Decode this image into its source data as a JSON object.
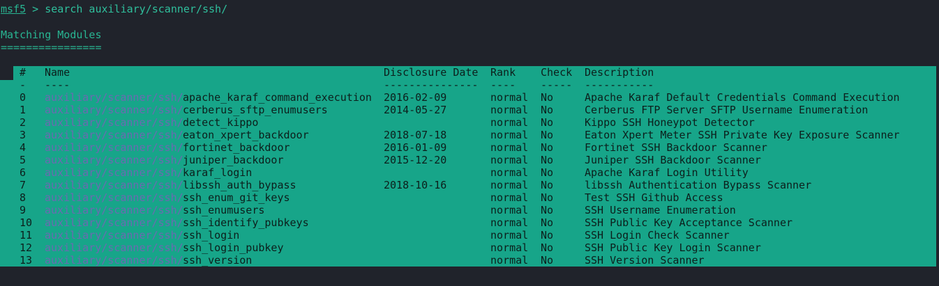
{
  "prompt": {
    "app": "msf5",
    "rest": " > search auxiliary/scanner/ssh/"
  },
  "heading": {
    "title": "Matching Modules",
    "underline": "================"
  },
  "table": {
    "headers": {
      "idx": "#",
      "name": "Name",
      "date": "Disclosure Date",
      "rank": "Rank",
      "check": "Check",
      "desc": "Description"
    },
    "separators": {
      "idx": "-",
      "name": "----",
      "date": "---------------",
      "rank": "----",
      "check": "-----",
      "desc": "-----------"
    },
    "path_prefix": "auxiliary/scanner/ssh/",
    "rows": [
      {
        "idx": "0",
        "name": "apache_karaf_command_execution",
        "date": "2016-02-09",
        "rank": "normal",
        "check": "No",
        "desc": "Apache Karaf Default Credentials Command Execution"
      },
      {
        "idx": "1",
        "name": "cerberus_sftp_enumusers",
        "date": "2014-05-27",
        "rank": "normal",
        "check": "No",
        "desc": "Cerberus FTP Server SFTP Username Enumeration"
      },
      {
        "idx": "2",
        "name": "detect_kippo",
        "date": "",
        "rank": "normal",
        "check": "No",
        "desc": "Kippo SSH Honeypot Detector"
      },
      {
        "idx": "3",
        "name": "eaton_xpert_backdoor",
        "date": "2018-07-18",
        "rank": "normal",
        "check": "No",
        "desc": "Eaton Xpert Meter SSH Private Key Exposure Scanner"
      },
      {
        "idx": "4",
        "name": "fortinet_backdoor",
        "date": "2016-01-09",
        "rank": "normal",
        "check": "No",
        "desc": "Fortinet SSH Backdoor Scanner"
      },
      {
        "idx": "5",
        "name": "juniper_backdoor",
        "date": "2015-12-20",
        "rank": "normal",
        "check": "No",
        "desc": "Juniper SSH Backdoor Scanner"
      },
      {
        "idx": "6",
        "name": "karaf_login",
        "date": "",
        "rank": "normal",
        "check": "No",
        "desc": "Apache Karaf Login Utility"
      },
      {
        "idx": "7",
        "name": "libssh_auth_bypass",
        "date": "2018-10-16",
        "rank": "normal",
        "check": "No",
        "desc": "libssh Authentication Bypass Scanner"
      },
      {
        "idx": "8",
        "name": "ssh_enum_git_keys",
        "date": "",
        "rank": "normal",
        "check": "No",
        "desc": "Test SSH Github Access"
      },
      {
        "idx": "9",
        "name": "ssh_enumusers",
        "date": "",
        "rank": "normal",
        "check": "No",
        "desc": "SSH Username Enumeration"
      },
      {
        "idx": "10",
        "name": "ssh_identify_pubkeys",
        "date": "",
        "rank": "normal",
        "check": "No",
        "desc": "SSH Public Key Acceptance Scanner"
      },
      {
        "idx": "11",
        "name": "ssh_login",
        "date": "",
        "rank": "normal",
        "check": "No",
        "desc": "SSH Login Check Scanner"
      },
      {
        "idx": "12",
        "name": "ssh_login_pubkey",
        "date": "",
        "rank": "normal",
        "check": "No",
        "desc": "SSH Public Key Login Scanner"
      },
      {
        "idx": "13",
        "name": "ssh_version",
        "date": "",
        "rank": "normal",
        "check": "No",
        "desc": "SSH Version Scanner"
      }
    ]
  },
  "colors": {
    "background": "#20232b",
    "selection": "#17a589",
    "accent_text": "#2fbf9c",
    "path_text": "#7a60b8"
  }
}
